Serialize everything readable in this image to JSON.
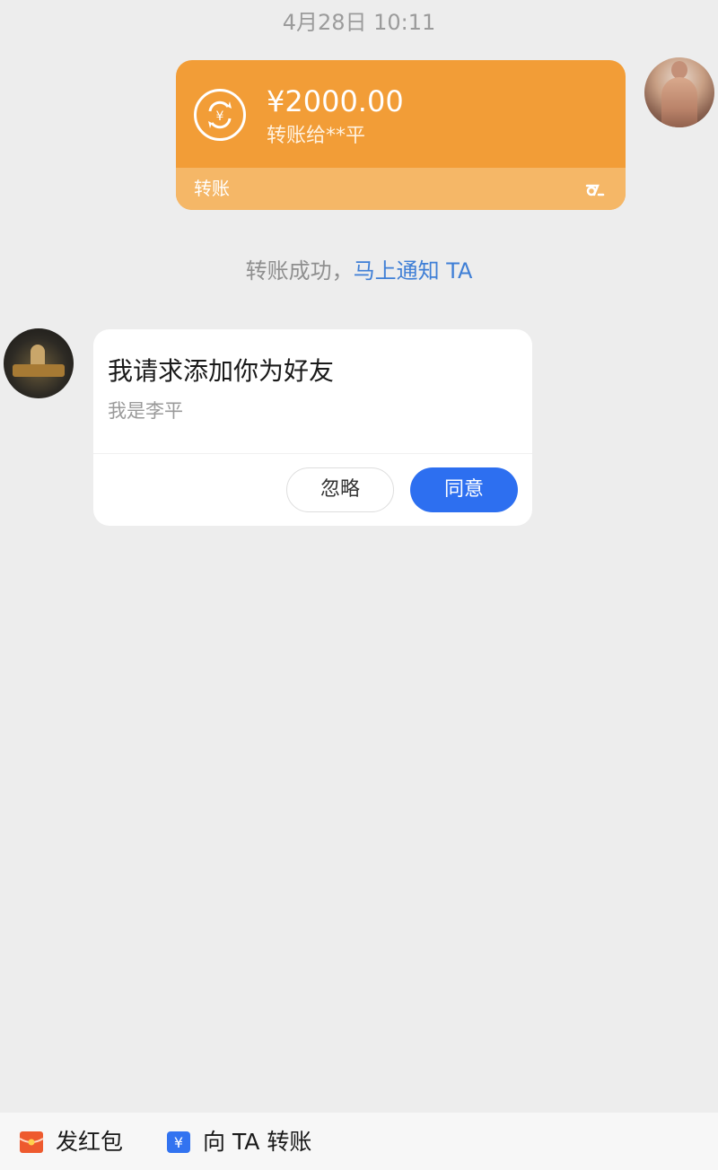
{
  "chat": {
    "timestamp": "4月28日 10:11"
  },
  "transfer": {
    "amount": "¥2000.00",
    "recipient": "转账给**平",
    "label": "转账",
    "card_color": "#f29d37"
  },
  "notice": {
    "text": "转账成功，",
    "link": "马上通知 TA",
    "link_color": "#3f7fd6"
  },
  "friend_request": {
    "title": "我请求添加你为好友",
    "subtitle": "我是李平",
    "ignore_label": "忽略",
    "agree_label": "同意",
    "agree_color": "#2d6ff0"
  },
  "toolbar": {
    "red_packet_label": "发红包",
    "transfer_label": "向 TA 转账",
    "red_packet_icon": "red-packet-icon",
    "transfer_icon": "yuan-transfer-icon"
  }
}
